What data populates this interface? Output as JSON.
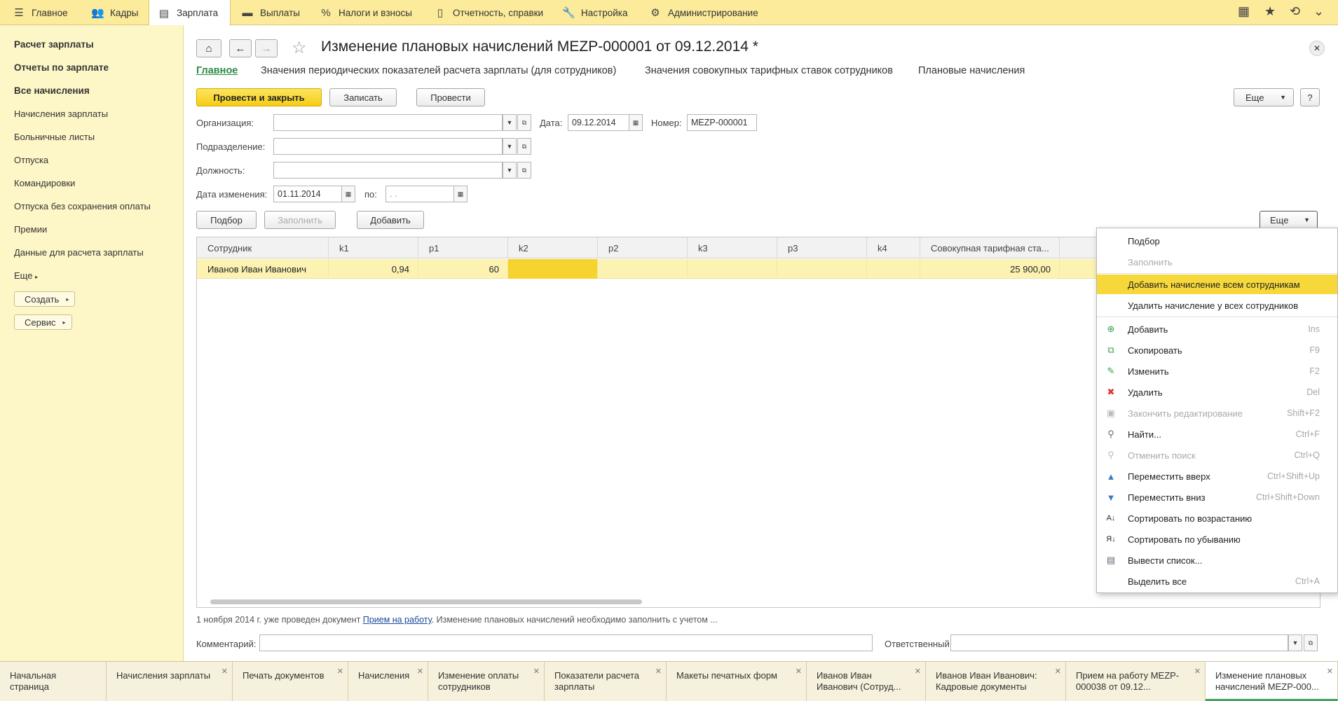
{
  "topbar": {
    "items": [
      {
        "label": "Главное",
        "icon": "menu-icon"
      },
      {
        "label": "Кадры",
        "icon": "people-icon"
      },
      {
        "label": "Зарплата",
        "icon": "payroll-icon"
      },
      {
        "label": "Выплаты",
        "icon": "wallet-icon"
      },
      {
        "label": "Налоги и взносы",
        "icon": "percent-icon"
      },
      {
        "label": "Отчетность, справки",
        "icon": "report-icon"
      },
      {
        "label": "Настройка",
        "icon": "wrench-icon"
      },
      {
        "label": "Администрирование",
        "icon": "gear-icon"
      }
    ]
  },
  "sidebar": {
    "bold": [
      "Расчет зарплаты",
      "Отчеты по зарплате",
      "Все начисления"
    ],
    "items": [
      "Начисления зарплаты",
      "Больничные листы",
      "Отпуска",
      "Командировки",
      "Отпуска без сохранения оплаты",
      "Премии",
      "Данные для расчета зарплаты"
    ],
    "more": "Еще",
    "create": "Создать",
    "service": "Сервис"
  },
  "doc": {
    "title": "Изменение плановых начислений MEZP-000001 от 09.12.2014 *",
    "tabs": [
      "Главное",
      "Значения периодических показателей расчета зарплаты (для сотрудников)",
      "Значения совокупных тарифных ставок сотрудников",
      "Плановые начисления"
    ],
    "toolbar": {
      "post_close": "Провести и закрыть",
      "save": "Записать",
      "post": "Провести",
      "more": "Еще",
      "help": "?"
    },
    "form": {
      "org_label": "Организация:",
      "org_value": "",
      "date_label": "Дата:",
      "date_value": "09.12.2014",
      "number_label": "Номер:",
      "number_value": "MEZP-000001",
      "dept_label": "Подразделение:",
      "dept_value": "",
      "position_label": "Должность:",
      "position_value": "",
      "change_date_label": "Дата изменения:",
      "change_date_value": "01.11.2014",
      "to_label": "по:",
      "to_value": " .  ."
    },
    "table_toolbar": {
      "pick": "Подбор",
      "fill": "Заполнить",
      "add": "Добавить",
      "more": "Еще"
    },
    "table": {
      "columns": [
        "Сотрудник",
        "k1",
        "p1",
        "k2",
        "p2",
        "k3",
        "p3",
        "k4",
        "Совокупная тарифная ста..."
      ],
      "row": {
        "employee": "Иванов Иван Иванович",
        "k1": "0,94",
        "p1": "60",
        "k2": "",
        "p2": "",
        "k3": "",
        "p3": "",
        "k4": "",
        "total": "25 900,00"
      }
    },
    "note": {
      "prefix": "1 ноября 2014 г.  уже проведен документ ",
      "link": "Прием на работу",
      "suffix": ". Изменение плановых начислений необходимо заполнить с учетом ..."
    },
    "comment_label": "Комментарий:",
    "comment_value": "",
    "responsible_label": "Ответственный:",
    "responsible_value": ""
  },
  "menu": {
    "items": [
      {
        "label": "Подбор",
        "shortcut": "",
        "icon": "",
        "state": "normal"
      },
      {
        "label": "Заполнить",
        "shortcut": "",
        "icon": "",
        "state": "disabled"
      },
      {
        "label": "Добавить начисление всем сотрудникам",
        "shortcut": "",
        "icon": "",
        "state": "highlighted"
      },
      {
        "label": "Удалить начисление у всех сотрудников",
        "shortcut": "",
        "icon": "",
        "state": "normal"
      },
      {
        "label": "Добавить",
        "shortcut": "Ins",
        "icon": "add-icon",
        "state": "normal"
      },
      {
        "label": "Скопировать",
        "shortcut": "F9",
        "icon": "copy-icon",
        "state": "normal"
      },
      {
        "label": "Изменить",
        "shortcut": "F2",
        "icon": "pencil-icon",
        "state": "normal"
      },
      {
        "label": "Удалить",
        "shortcut": "Del",
        "icon": "delete-icon",
        "state": "normal"
      },
      {
        "label": "Закончить редактирование",
        "shortcut": "Shift+F2",
        "icon": "finish-edit-icon",
        "state": "disabled"
      },
      {
        "label": "Найти...",
        "shortcut": "Ctrl+F",
        "icon": "search-icon",
        "state": "normal"
      },
      {
        "label": "Отменить поиск",
        "shortcut": "Ctrl+Q",
        "icon": "cancel-search-icon",
        "state": "disabled"
      },
      {
        "label": "Переместить вверх",
        "shortcut": "Ctrl+Shift+Up",
        "icon": "arrow-up-icon",
        "state": "normal"
      },
      {
        "label": "Переместить вниз",
        "shortcut": "Ctrl+Shift+Down",
        "icon": "arrow-down-icon",
        "state": "normal"
      },
      {
        "label": "Сортировать по возрастанию",
        "shortcut": "",
        "icon": "sort-asc-icon",
        "state": "normal"
      },
      {
        "label": "Сортировать по убыванию",
        "shortcut": "",
        "icon": "sort-desc-icon",
        "state": "normal"
      },
      {
        "label": "Вывести список...",
        "shortcut": "",
        "icon": "print-list-icon",
        "state": "normal"
      },
      {
        "label": "Выделить все",
        "shortcut": "Ctrl+A",
        "icon": "",
        "state": "normal"
      }
    ]
  },
  "taskbar": {
    "items": [
      {
        "label": "Начальная страница",
        "closable": false
      },
      {
        "label": "Начисления зарплаты",
        "closable": true
      },
      {
        "label": "Печать документов",
        "closable": true
      },
      {
        "label": "Начисления",
        "closable": true
      },
      {
        "label": "Изменение оплаты сотрудников",
        "closable": true
      },
      {
        "label": "Показатели расчета зарплаты",
        "closable": true
      },
      {
        "label": "Макеты печатных форм",
        "closable": true
      },
      {
        "label": "Иванов Иван Иванович (Сотруд...",
        "closable": true
      },
      {
        "label": "Иванов Иван Иванович: Кадровые документы",
        "closable": true
      },
      {
        "label": "Прием на работу MEZP-000038 от 09.12...",
        "closable": true
      },
      {
        "label": "Изменение плановых начислений MEZP-000...",
        "closable": true
      }
    ]
  },
  "colors": {
    "accent_yellow": "#f7d83a",
    "topbar_bg": "#fbeb9a",
    "sidebar_bg": "#fdf6c7",
    "link_green": "#2a8a43"
  }
}
